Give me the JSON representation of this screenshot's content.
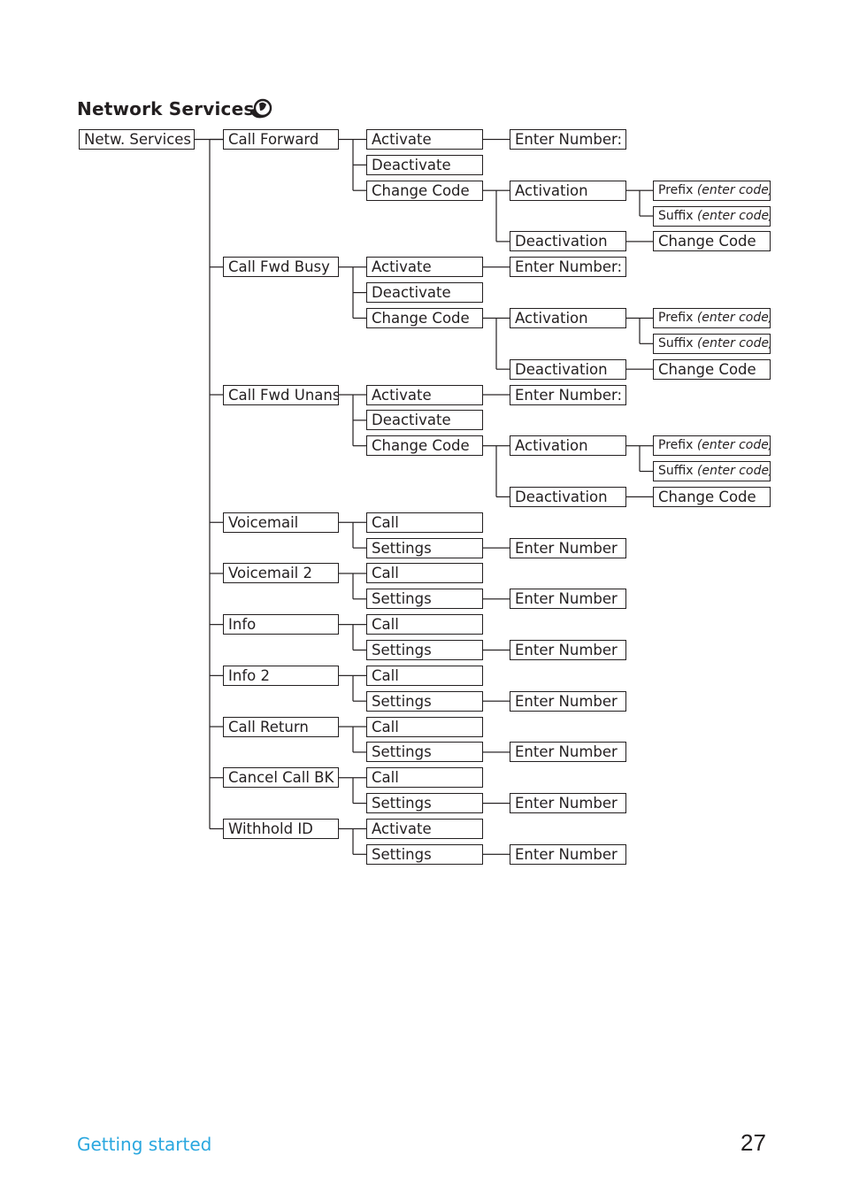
{
  "page": {
    "title": "Network Services",
    "title_icon": "network-services-icon",
    "footer_section": "Getting started",
    "page_number": "27"
  },
  "tree": {
    "root": "Netw. Services",
    "items": [
      {
        "label": "Call Forward",
        "children": [
          {
            "label": "Activate",
            "children": [
              {
                "label": "Enter Number:"
              }
            ]
          },
          {
            "label": "Deactivate"
          },
          {
            "label": "Change Code",
            "children": [
              {
                "label": "Activation",
                "children": [
                  {
                    "label": "Prefix",
                    "note": "(enter code)"
                  },
                  {
                    "label": "Suffix",
                    "note": "(enter code)"
                  }
                ]
              },
              {
                "label": "Deactivation",
                "children": [
                  {
                    "label": "Change Code"
                  }
                ]
              }
            ]
          }
        ]
      },
      {
        "label": "Call Fwd Busy",
        "children": [
          {
            "label": "Activate",
            "children": [
              {
                "label": "Enter Number:"
              }
            ]
          },
          {
            "label": "Deactivate"
          },
          {
            "label": "Change Code",
            "children": [
              {
                "label": "Activation",
                "children": [
                  {
                    "label": "Prefix",
                    "note": "(enter code)"
                  },
                  {
                    "label": "Suffix",
                    "note": "(enter code)"
                  }
                ]
              },
              {
                "label": "Deactivation",
                "children": [
                  {
                    "label": "Change Code"
                  }
                ]
              }
            ]
          }
        ]
      },
      {
        "label": "Call Fwd Unans",
        "children": [
          {
            "label": "Activate",
            "children": [
              {
                "label": "Enter Number:"
              }
            ]
          },
          {
            "label": "Deactivate"
          },
          {
            "label": "Change Code",
            "children": [
              {
                "label": "Activation",
                "children": [
                  {
                    "label": "Prefix",
                    "note": "(enter code)"
                  },
                  {
                    "label": "Suffix",
                    "note": "(enter code)"
                  }
                ]
              },
              {
                "label": "Deactivation",
                "children": [
                  {
                    "label": "Change Code"
                  }
                ]
              }
            ]
          }
        ]
      },
      {
        "label": "Voicemail",
        "children": [
          {
            "label": "Call"
          },
          {
            "label": "Settings",
            "children": [
              {
                "label": "Enter Number"
              }
            ]
          }
        ]
      },
      {
        "label": "Voicemail 2",
        "children": [
          {
            "label": "Call"
          },
          {
            "label": "Settings",
            "children": [
              {
                "label": "Enter Number"
              }
            ]
          }
        ]
      },
      {
        "label": "Info",
        "children": [
          {
            "label": "Call"
          },
          {
            "label": "Settings",
            "children": [
              {
                "label": "Enter Number"
              }
            ]
          }
        ]
      },
      {
        "label": "Info 2",
        "children": [
          {
            "label": "Call"
          },
          {
            "label": "Settings",
            "children": [
              {
                "label": "Enter Number"
              }
            ]
          }
        ]
      },
      {
        "label": "Call Return",
        "children": [
          {
            "label": "Call"
          },
          {
            "label": "Settings",
            "children": [
              {
                "label": "Enter Number"
              }
            ]
          }
        ]
      },
      {
        "label": "Cancel Call BK",
        "children": [
          {
            "label": "Call"
          },
          {
            "label": "Settings",
            "children": [
              {
                "label": "Enter Number"
              }
            ]
          }
        ]
      },
      {
        "label": "Withhold ID",
        "children": [
          {
            "label": "Activate"
          },
          {
            "label": "Settings",
            "children": [
              {
                "label": "Enter Number"
              }
            ]
          }
        ]
      }
    ]
  }
}
